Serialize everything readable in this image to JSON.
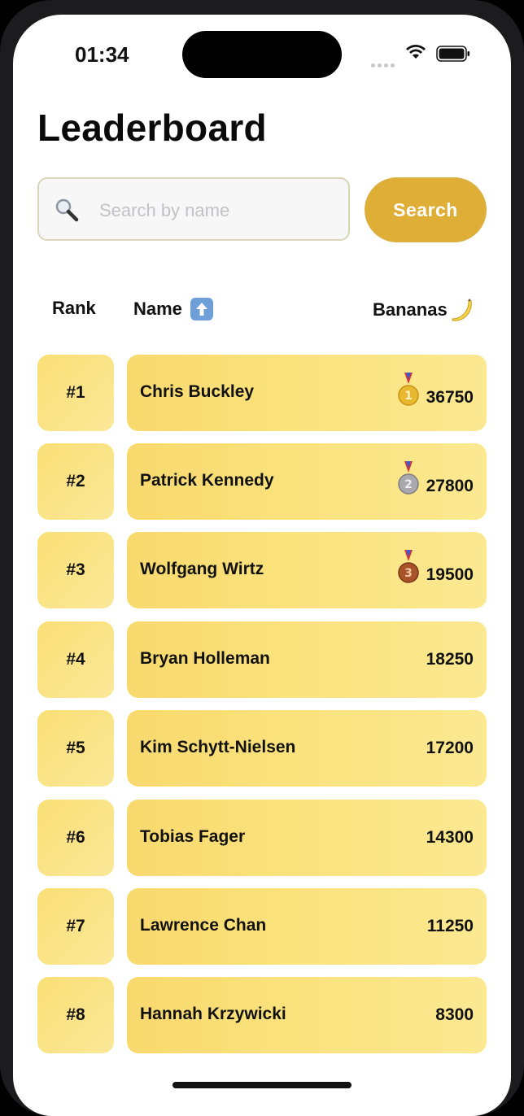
{
  "status_bar": {
    "time": "01:34"
  },
  "page": {
    "title": "Leaderboard"
  },
  "search": {
    "placeholder": "Search by name",
    "value": "",
    "button_label": "Search"
  },
  "table_header": {
    "rank": "Rank",
    "name": "Name",
    "bananas": "Bananas"
  },
  "rows": [
    {
      "rank": "#1",
      "name": "Chris Buckley",
      "score": "36750",
      "medal": "gold-medal-icon"
    },
    {
      "rank": "#2",
      "name": "Patrick Kennedy",
      "score": "27800",
      "medal": "silver-medal-icon"
    },
    {
      "rank": "#3",
      "name": "Wolfgang Wirtz",
      "score": "19500",
      "medal": "bronze-medal-icon"
    },
    {
      "rank": "#4",
      "name": "Bryan Holleman",
      "score": "18250"
    },
    {
      "rank": "#5",
      "name": "Kim Schytt-Nielsen",
      "score": "17200"
    },
    {
      "rank": "#6",
      "name": "Tobias Fager",
      "score": "14300"
    },
    {
      "rank": "#7",
      "name": "Lawrence Chan",
      "score": "11250"
    },
    {
      "rank": "#8",
      "name": "Hannah Krzywicki",
      "score": "8300"
    }
  ],
  "colors": {
    "accent": "#dfae36",
    "row_fill": "#fae27c",
    "gold": "#e8b830",
    "silver": "#a9a9ad",
    "bronze": "#a8532a"
  },
  "icons": {
    "search": "magnifier-icon",
    "sort": "arrow-up-icon",
    "bananas": "banana-icon"
  }
}
